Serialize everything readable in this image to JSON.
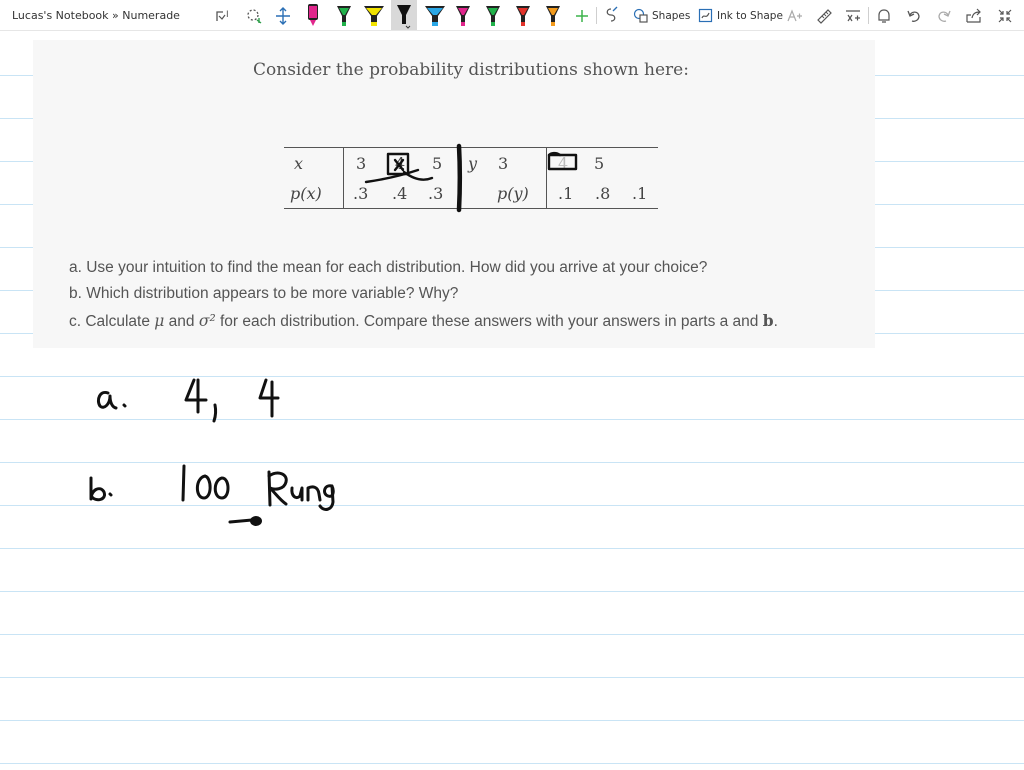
{
  "toolbar": {
    "breadcrumb": "Lucas's Notebook » Numerade",
    "shapes_label": "Shapes",
    "ink_to_shape_label": "Ink to Shape",
    "colors": {
      "pen_pink": "#e0268c",
      "pen_green": "#21b24b",
      "pen_yellow": "#f2e300",
      "pen_black": "#111111",
      "pen_blue": "#2aa7e6",
      "pen_red": "#e2332b",
      "pen_orange": "#f29a1c",
      "add_green": "#3cb44b"
    }
  },
  "problem": {
    "title": "Consider the probability distributions shown here:",
    "table_left": {
      "var_label": "x",
      "prob_label": "p(x)",
      "values": [
        "3",
        "4",
        "5"
      ],
      "probs": [
        ".3",
        ".4",
        ".3"
      ]
    },
    "table_right": {
      "var_label": "y",
      "prob_label": "p(y)",
      "values": [
        "3",
        "4",
        "5"
      ],
      "probs": [
        ".1",
        ".8",
        ".1"
      ]
    },
    "parts": {
      "a": "a. Use your intuition to find the mean for each distribution. How did you arrive at your choice?",
      "b": "b. Which distribution appears to be more variable? Why?",
      "c_pre": "c. Calculate ",
      "c_mu": "μ",
      "c_and": " and ",
      "c_sigma": "σ²",
      "c_post": " for each distribution. Compare these answers with your answers in parts a and ",
      "c_bold": "b",
      "c_end": "."
    }
  }
}
